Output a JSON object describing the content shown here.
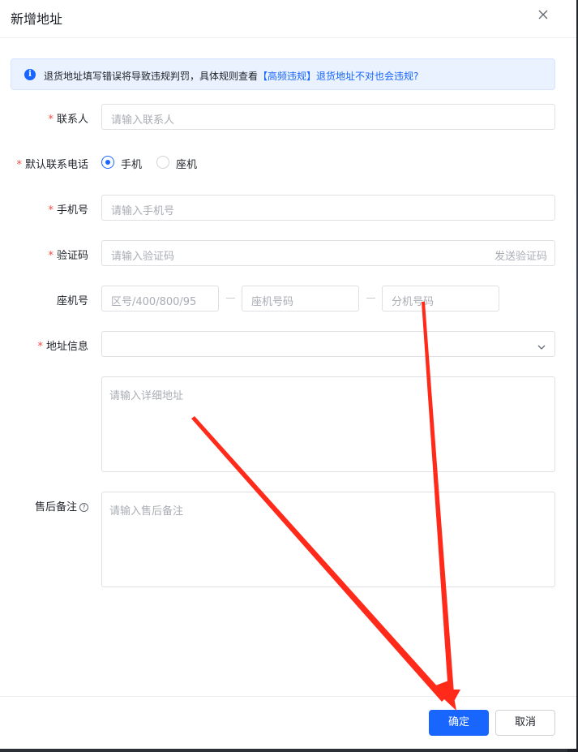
{
  "dialog": {
    "title": "新增地址",
    "notice": {
      "text": "退货地址填写错误将导致违规判罚，具体规则查看",
      "link1": "【高频违规】",
      "link2": "退货地址不对也会违规?"
    }
  },
  "form": {
    "contact": {
      "label": "联系人",
      "placeholder": "请输入联系人"
    },
    "default_phone": {
      "label": "默认联系电话",
      "options": [
        "手机",
        "座机"
      ],
      "selected": "手机"
    },
    "mobile": {
      "label": "手机号",
      "placeholder": "请输入手机号"
    },
    "verify_code": {
      "label": "验证码",
      "placeholder": "请输入验证码",
      "action": "发送验证码"
    },
    "landline": {
      "label": "座机号",
      "area_placeholder": "区号/400/800/95",
      "number_placeholder": "座机号码",
      "ext_placeholder": "分机号码"
    },
    "address": {
      "label": "地址信息",
      "detail_placeholder": "请输入详细地址"
    },
    "remark": {
      "label": "售后备注",
      "placeholder": "请输入售后备注"
    }
  },
  "footer": {
    "confirm": "确定",
    "cancel": "取消"
  },
  "colors": {
    "primary": "#1966ff",
    "required": "#f54a45",
    "annotation_arrow": "#ff2a1a"
  }
}
